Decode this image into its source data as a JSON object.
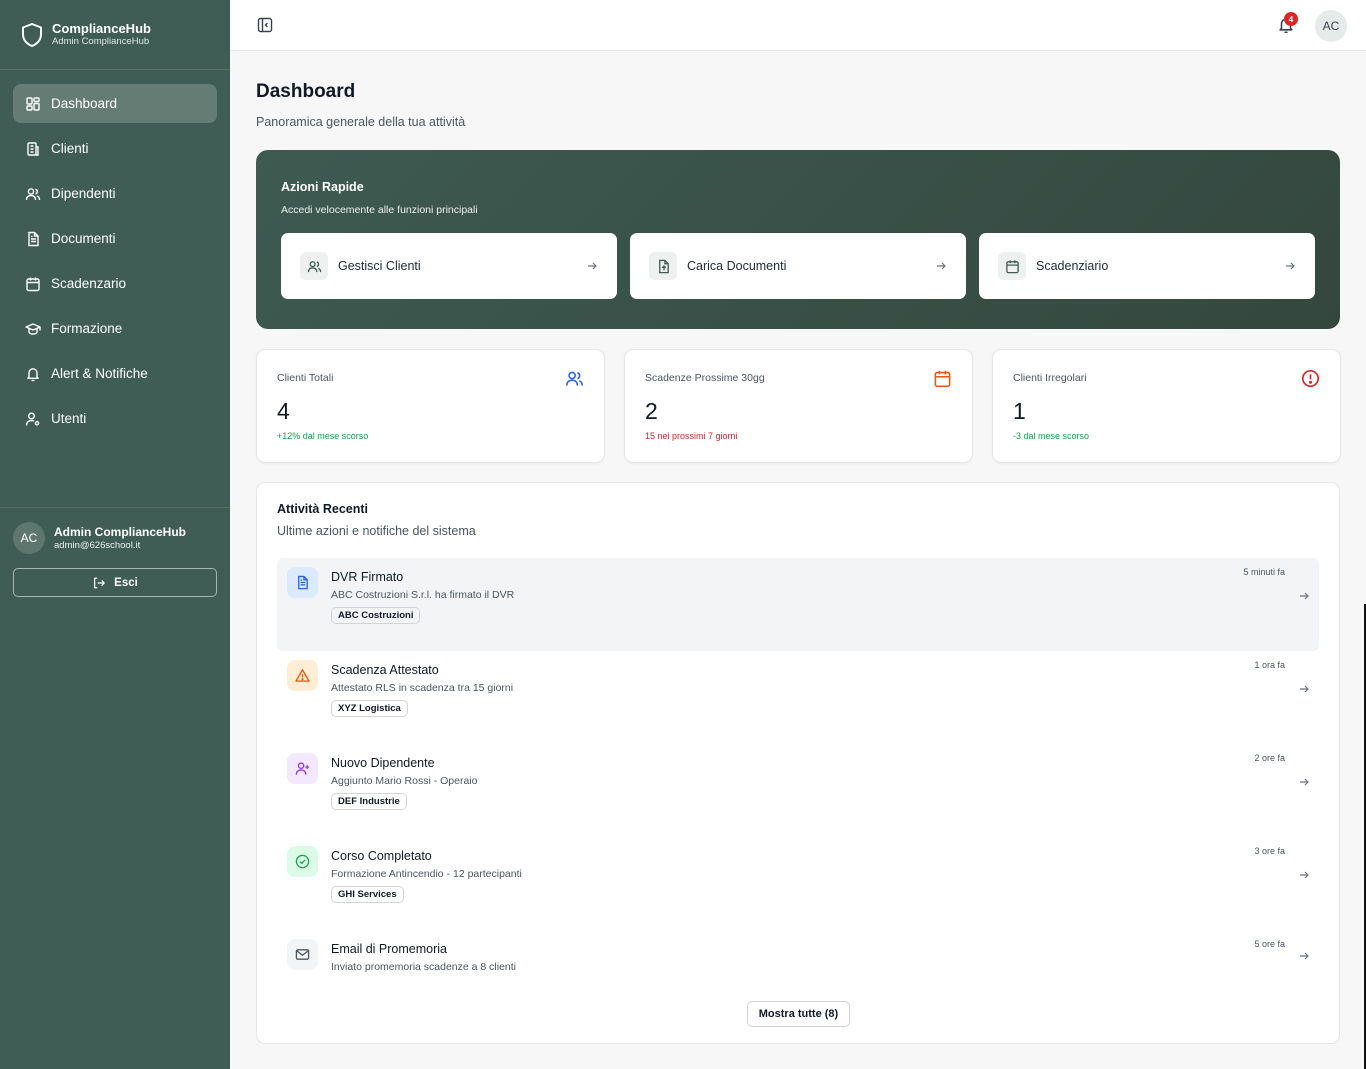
{
  "brand": {
    "title": "ComplianceHub",
    "subtitle": "Admin ComplianceHub"
  },
  "sidebar": {
    "items": [
      {
        "label": "Dashboard",
        "icon": "layout-grid-icon",
        "active": true
      },
      {
        "label": "Clienti",
        "icon": "building-icon"
      },
      {
        "label": "Dipendenti",
        "icon": "users-icon"
      },
      {
        "label": "Documenti",
        "icon": "file-text-icon"
      },
      {
        "label": "Scadenzario",
        "icon": "calendar-icon"
      },
      {
        "label": "Formazione",
        "icon": "graduation-cap-icon"
      },
      {
        "label": "Alert & Notifiche",
        "icon": "bell-icon"
      },
      {
        "label": "Utenti",
        "icon": "user-cog-icon"
      }
    ],
    "user": {
      "initials": "AC",
      "name": "Admin ComplianceHub",
      "email": "admin@626school.it"
    },
    "logout_label": "Esci"
  },
  "topbar": {
    "notifications_count": "4",
    "avatar_initials": "AC"
  },
  "page": {
    "title": "Dashboard",
    "subtitle": "Panoramica generale della tua attività"
  },
  "quick_actions": {
    "title": "Azioni Rapide",
    "subtitle": "Accedi velocemente alle funzioni principali",
    "cards": [
      {
        "label": "Gestisci Clienti",
        "icon": "users-icon"
      },
      {
        "label": "Carica Documenti",
        "icon": "file-upload-icon"
      },
      {
        "label": "Scadenziario",
        "icon": "calendar-icon"
      }
    ]
  },
  "stats": [
    {
      "label": "Clienti Totali",
      "value": "4",
      "note": "+12% dal mese scorso",
      "note_color": "#16a34a",
      "icon_color": "#2563eb"
    },
    {
      "label": "Scadenze Prossime 30gg",
      "value": "2",
      "note": "15 nei prossimi 7 giorni",
      "note_color": "#dc2626",
      "icon_color": "#ea580c"
    },
    {
      "label": "Clienti Irregolari",
      "value": "1",
      "note": "-3 dal mese scorso",
      "note_color": "#16a34a",
      "icon_color": "#dc2626"
    }
  ],
  "activity": {
    "title": "Attività Recenti",
    "subtitle": "Ultime azioni e notifiche del sistema",
    "items": [
      {
        "title": "DVR Firmato",
        "desc": "ABC Costruzioni S.r.l. ha firmato il DVR",
        "tag": "ABC Costruzioni",
        "time": "5 minuti fa"
      },
      {
        "title": "Scadenza Attestato",
        "desc": "Attestato RLS in scadenza tra 15 giorni",
        "tag": "XYZ Logistica",
        "time": "1 ora fa"
      },
      {
        "title": "Nuovo Dipendente",
        "desc": "Aggiunto Mario Rossi - Operaio",
        "tag": "DEF Industrie",
        "time": "2 ore fa"
      },
      {
        "title": "Corso Completato",
        "desc": "Formazione Antincendio - 12 partecipanti",
        "tag": "GHI Services",
        "time": "3 ore fa"
      },
      {
        "title": "Email di Promemoria",
        "desc": "Inviato promemoria scadenze a 8 clienti",
        "tag": "",
        "time": "5 ore fa"
      }
    ],
    "show_all_label": "Mostra tutte (8)"
  }
}
